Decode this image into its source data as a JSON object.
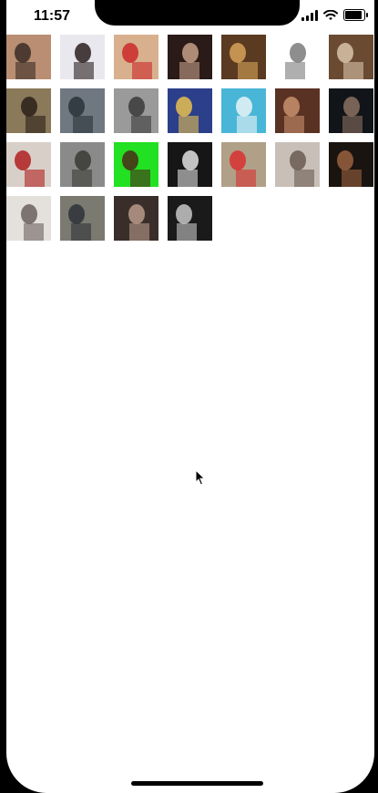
{
  "status_bar": {
    "time": "11:57",
    "icons": [
      "signal-icon",
      "wifi-icon",
      "battery-icon"
    ]
  },
  "gallery": {
    "columns": 7,
    "thumbnails": [
      {
        "label": "",
        "bg": "#b98e72",
        "accent": "#3a2b24"
      },
      {
        "label": "",
        "bg": "#e9e8ee",
        "accent": "#2a1f1f"
      },
      {
        "label": "",
        "bg": "#d8b08e",
        "accent": "#cc2a2a"
      },
      {
        "label": "",
        "bg": "#2a1a18",
        "accent": "#c6a088"
      },
      {
        "label": "",
        "bg": "#5a3a20",
        "accent": "#d7a35a"
      },
      {
        "label": "",
        "bg": "#ffffff",
        "accent": "#7a7a7a"
      },
      {
        "label": "",
        "bg": "#6a4a30",
        "accent": "#d8c3a8"
      },
      {
        "label": "",
        "bg": "#8a7a5a",
        "accent": "#2a1e18"
      },
      {
        "label": "",
        "bg": "#6f7780",
        "accent": "#2c3339"
      },
      {
        "label": "",
        "bg": "#9a9a9a",
        "accent": "#3a3a3a"
      },
      {
        "label": "",
        "bg": "#2c3f8a",
        "accent": "#e8c050"
      },
      {
        "label": "",
        "bg": "#49b6d7",
        "accent": "#e9f4f7"
      },
      {
        "label": "",
        "bg": "#5a3224",
        "accent": "#c7906c"
      },
      {
        "label": "",
        "bg": "#111418",
        "accent": "#8a7060"
      },
      {
        "label": "",
        "bg": "#d8d0c8",
        "accent": "#b02020"
      },
      {
        "label": "",
        "bg": "#8a8a8a",
        "accent": "#3a3a34"
      },
      {
        "label": "",
        "bg": "#22e022",
        "accent": "#4a2a18"
      },
      {
        "label": "",
        "bg": "#161616",
        "accent": "#e0e0e0"
      },
      {
        "label": "",
        "bg": "#b0a088",
        "accent": "#d83030"
      },
      {
        "label": "",
        "bg": "#c8c0b8",
        "accent": "#6a5a50"
      },
      {
        "label": "",
        "bg": "#1a1410",
        "accent": "#9a6040"
      },
      {
        "label": "",
        "bg": "#e4e0dc",
        "accent": "#6a6060"
      },
      {
        "label": "",
        "bg": "#7a7a70",
        "accent": "#2e3238"
      },
      {
        "label": "",
        "bg": "#3a2e2a",
        "accent": "#b89a8a"
      },
      {
        "label": "",
        "bg": "#1a1a1a",
        "accent": "#c8c8c8"
      }
    ]
  }
}
